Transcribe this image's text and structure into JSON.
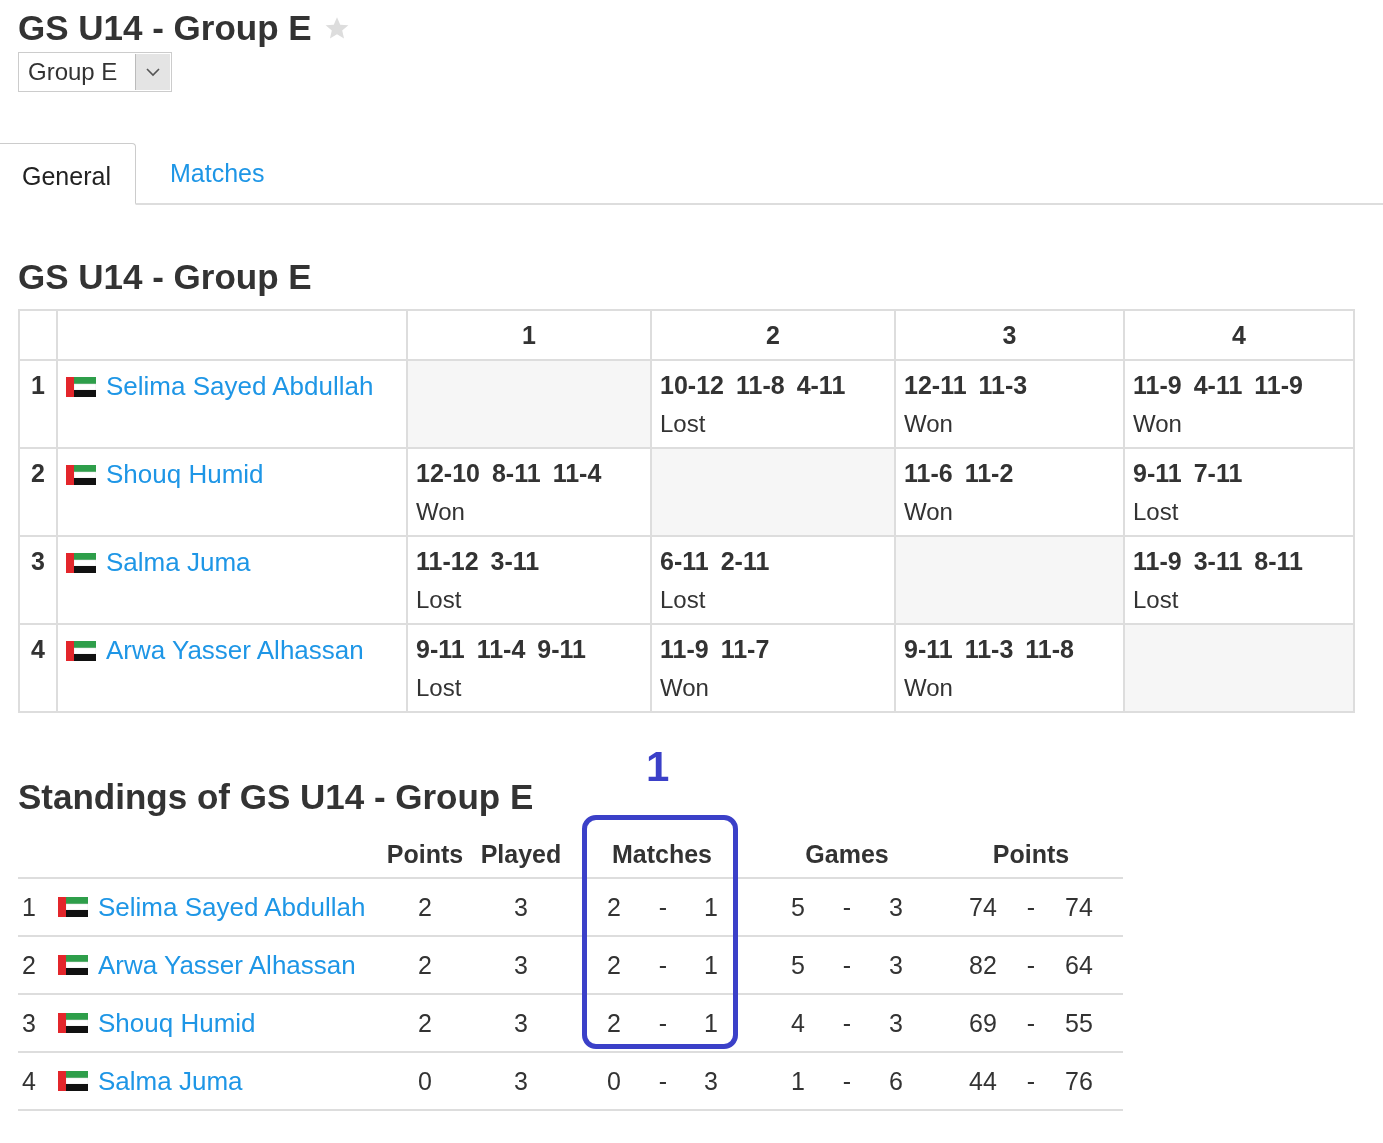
{
  "page_title": "GS U14 - Group E",
  "favorite": false,
  "group_select": {
    "value": "Group E"
  },
  "tabs": [
    {
      "label": "General",
      "selected": true
    },
    {
      "label": "Matches",
      "selected": false
    }
  ],
  "grid": {
    "title": "GS U14 - Group E",
    "columns": [
      "1",
      "2",
      "3",
      "4"
    ],
    "rows": [
      {
        "rank": "1",
        "player": "Selima Sayed Abdullah",
        "results": [
          {
            "kind": "self"
          },
          {
            "kind": "match",
            "games": [
              "10-12",
              "11-8",
              "4-11"
            ],
            "outcome": "Lost"
          },
          {
            "kind": "match",
            "games": [
              "12-11",
              "11-3"
            ],
            "outcome": "Won"
          },
          {
            "kind": "match",
            "games": [
              "11-9",
              "4-11",
              "11-9"
            ],
            "outcome": "Won"
          }
        ]
      },
      {
        "rank": "2",
        "player": "Shouq Humid",
        "results": [
          {
            "kind": "match",
            "games": [
              "12-10",
              "8-11",
              "11-4"
            ],
            "outcome": "Won"
          },
          {
            "kind": "self"
          },
          {
            "kind": "match",
            "games": [
              "11-6",
              "11-2"
            ],
            "outcome": "Won"
          },
          {
            "kind": "match",
            "games": [
              "9-11",
              "7-11"
            ],
            "outcome": "Lost"
          }
        ]
      },
      {
        "rank": "3",
        "player": "Salma Juma",
        "results": [
          {
            "kind": "match",
            "games": [
              "11-12",
              "3-11"
            ],
            "outcome": "Lost"
          },
          {
            "kind": "match",
            "games": [
              "6-11",
              "2-11"
            ],
            "outcome": "Lost"
          },
          {
            "kind": "self"
          },
          {
            "kind": "match",
            "games": [
              "11-9",
              "3-11",
              "8-11"
            ],
            "outcome": "Lost"
          }
        ]
      },
      {
        "rank": "4",
        "player": "Arwa Yasser Alhassan",
        "results": [
          {
            "kind": "match",
            "games": [
              "9-11",
              "11-4",
              "9-11"
            ],
            "outcome": "Lost"
          },
          {
            "kind": "match",
            "games": [
              "11-9",
              "11-7"
            ],
            "outcome": "Won"
          },
          {
            "kind": "match",
            "games": [
              "9-11",
              "11-3",
              "11-8"
            ],
            "outcome": "Won"
          },
          {
            "kind": "self"
          }
        ]
      }
    ]
  },
  "standings": {
    "title": "Standings of GS U14 - Group E",
    "columns": [
      "Points",
      "Played",
      "Matches",
      "Games",
      "Points"
    ],
    "rows": [
      {
        "rank": "1",
        "player": "Selima Sayed Abdullah",
        "points": "2",
        "played": "3",
        "matches": [
          "2",
          "-",
          "1"
        ],
        "games": [
          "5",
          "-",
          "3"
        ],
        "score": [
          "74",
          "-",
          "74"
        ]
      },
      {
        "rank": "2",
        "player": "Arwa Yasser Alhassan",
        "points": "2",
        "played": "3",
        "matches": [
          "2",
          "-",
          "1"
        ],
        "games": [
          "5",
          "-",
          "3"
        ],
        "score": [
          "82",
          "-",
          "64"
        ]
      },
      {
        "rank": "3",
        "player": "Shouq Humid",
        "points": "2",
        "played": "3",
        "matches": [
          "2",
          "-",
          "1"
        ],
        "games": [
          "4",
          "-",
          "3"
        ],
        "score": [
          "69",
          "-",
          "55"
        ]
      },
      {
        "rank": "4",
        "player": "Salma Juma",
        "points": "0",
        "played": "3",
        "matches": [
          "0",
          "-",
          "3"
        ],
        "games": [
          "1",
          "-",
          "6"
        ],
        "score": [
          "44",
          "-",
          "76"
        ]
      }
    ]
  },
  "callout": {
    "label": "1"
  }
}
